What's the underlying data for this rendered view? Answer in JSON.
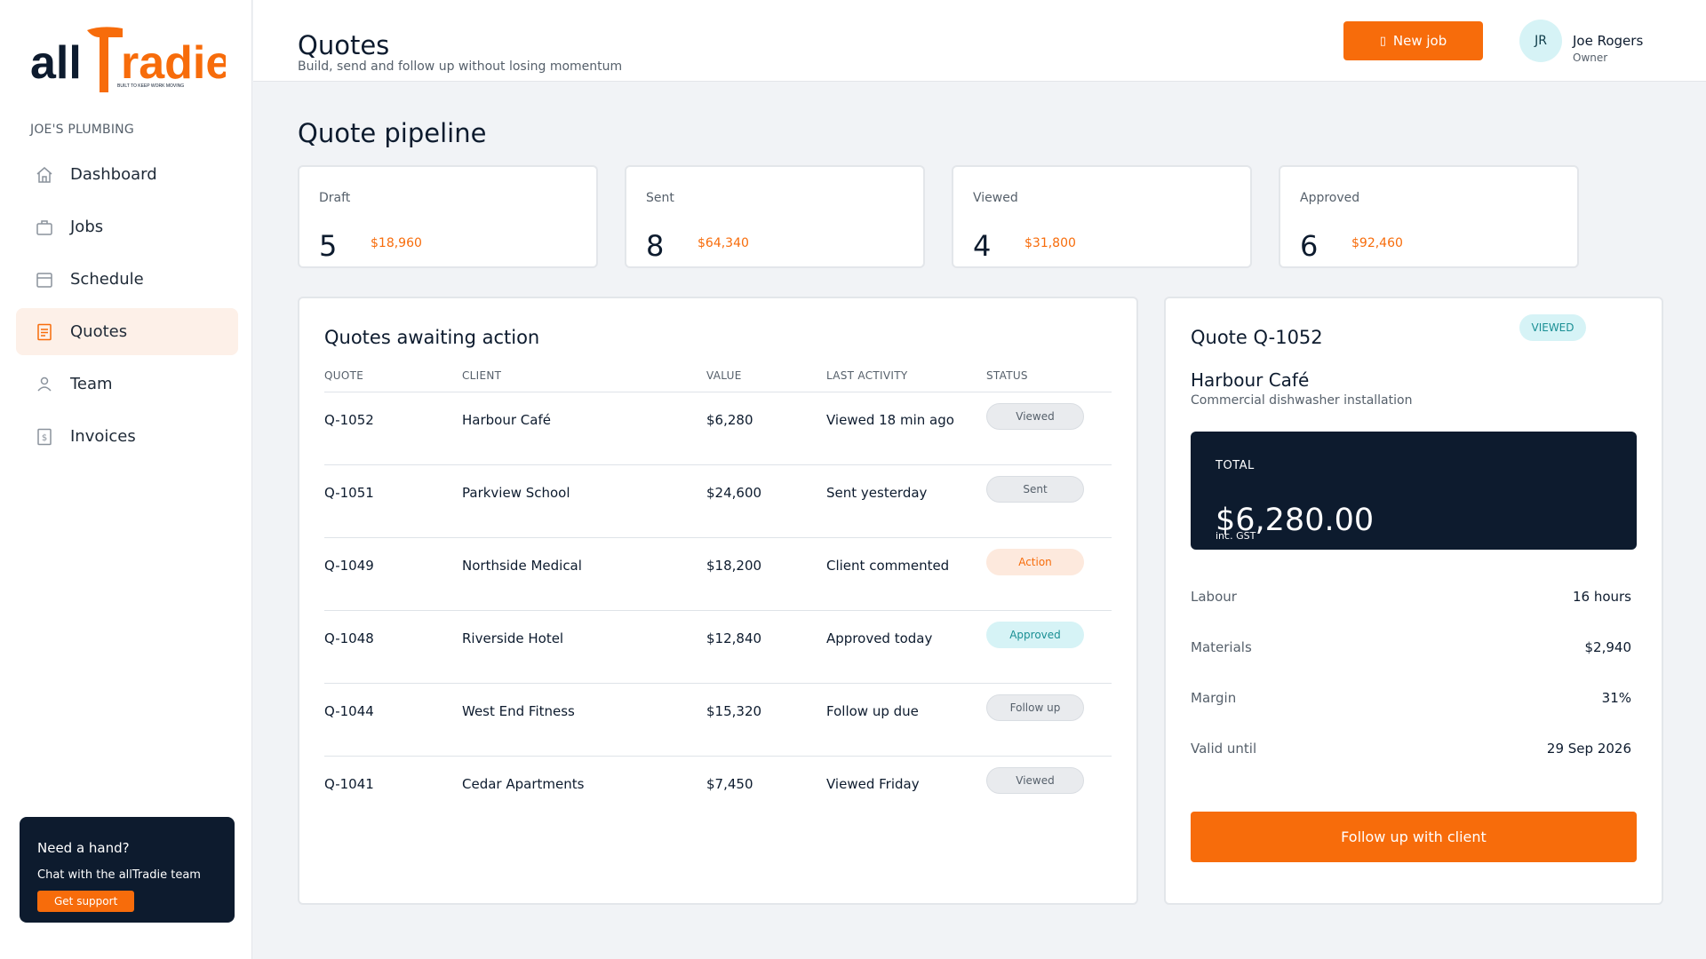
{
  "brand": {
    "logo_word_left": "all",
    "logo_word_right": "radie",
    "tagline": "BUILT TO KEEP WORK MOVING",
    "accent": "#f76c0b",
    "navy": "#0d1b2e"
  },
  "sidebar": {
    "org": "JOE'S PLUMBING",
    "items": [
      {
        "label": "Dashboard",
        "icon": "home-icon",
        "active": false
      },
      {
        "label": "Jobs",
        "icon": "briefcase-icon",
        "active": false
      },
      {
        "label": "Schedule",
        "icon": "calendar-icon",
        "active": false
      },
      {
        "label": "Quotes",
        "icon": "document-icon",
        "active": true
      },
      {
        "label": "Team",
        "icon": "user-icon",
        "active": false
      },
      {
        "label": "Invoices",
        "icon": "invoice-icon",
        "active": false
      }
    ],
    "help": {
      "title": "Need a hand?",
      "text": "Chat with the allTradie team",
      "button": "Get support"
    }
  },
  "header": {
    "title": "Quotes",
    "subtitle": "Build, send and follow up without losing momentum",
    "new_job": "New job",
    "user": {
      "initials": "JR",
      "name": "Joe Rogers",
      "role": "Owner"
    }
  },
  "pipeline": {
    "title": "Quote pipeline",
    "stats": [
      {
        "label": "Draft",
        "count": "5",
        "amount": "$18,960"
      },
      {
        "label": "Sent",
        "count": "8",
        "amount": "$64,340"
      },
      {
        "label": "Viewed",
        "count": "4",
        "amount": "$31,800"
      },
      {
        "label": "Approved",
        "count": "6",
        "amount": "$92,460"
      }
    ]
  },
  "awaiting": {
    "title": "Quotes awaiting action",
    "columns": [
      "QUOTE",
      "CLIENT",
      "VALUE",
      "LAST ACTIVITY",
      "STATUS"
    ],
    "rows": [
      {
        "quote": "Q-1052",
        "client": "Harbour Café",
        "value": "$6,280",
        "activity": "Viewed 18 min ago",
        "status": "Viewed",
        "kind": "neutral"
      },
      {
        "quote": "Q-1051",
        "client": "Parkview School",
        "value": "$24,600",
        "activity": "Sent yesterday",
        "status": "Sent",
        "kind": "neutral"
      },
      {
        "quote": "Q-1049",
        "client": "Northside Medical",
        "value": "$18,200",
        "activity": "Client commented",
        "status": "Action",
        "kind": "action"
      },
      {
        "quote": "Q-1048",
        "client": "Riverside Hotel",
        "value": "$12,840",
        "activity": "Approved today",
        "status": "Approved",
        "kind": "approved"
      },
      {
        "quote": "Q-1044",
        "client": "West End Fitness",
        "value": "$15,320",
        "activity": "Follow up due",
        "status": "Follow up",
        "kind": "neutral"
      },
      {
        "quote": "Q-1041",
        "client": "Cedar Apartments",
        "value": "$7,450",
        "activity": "Viewed Friday",
        "status": "Viewed",
        "kind": "neutral"
      }
    ]
  },
  "detail": {
    "quote_title": "Quote Q-1052",
    "badge": "VIEWED",
    "client": "Harbour Café",
    "description": "Commercial dishwasher installation",
    "total_label": "TOTAL",
    "total_value": "$6,280.00",
    "total_note": "inc. GST",
    "rows": [
      {
        "key": "Labour",
        "value": "16 hours"
      },
      {
        "key": "Materials",
        "value": "$2,940"
      },
      {
        "key": "Margin",
        "value": "31%"
      },
      {
        "key": "Valid until",
        "value": "29 Sep 2026"
      }
    ],
    "action": "Follow up with client"
  }
}
